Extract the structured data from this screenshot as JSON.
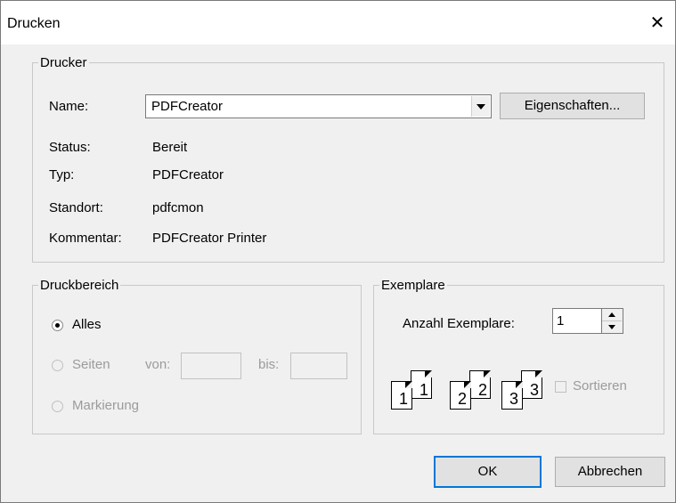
{
  "window": {
    "title": "Drucken",
    "close_glyph": "✕"
  },
  "printer": {
    "legend": "Drucker",
    "name_label": "Name:",
    "name_value": "PDFCreator",
    "properties_button": "Eigenschaften...",
    "status_label": "Status:",
    "status_value": "Bereit",
    "type_label": "Typ:",
    "type_value": "PDFCreator",
    "location_label": "Standort:",
    "location_value": "pdfcmon",
    "comment_label": "Kommentar:",
    "comment_value": "PDFCreator Printer"
  },
  "range": {
    "legend": "Druckbereich",
    "all_label": "Alles",
    "pages_label": "Seiten",
    "from_label": "von:",
    "to_label": "bis:",
    "selection_label": "Markierung",
    "selected": "all"
  },
  "copies": {
    "legend": "Exemplare",
    "count_label": "Anzahl Exemplare:",
    "count_value": "1",
    "collate_label": "Sortieren",
    "collate_checked": false,
    "collate_icons": [
      {
        "back": "1",
        "front": "1"
      },
      {
        "back": "2",
        "front": "2"
      },
      {
        "back": "3",
        "front": "3"
      }
    ]
  },
  "buttons": {
    "ok": "OK",
    "cancel": "Abbrechen"
  }
}
